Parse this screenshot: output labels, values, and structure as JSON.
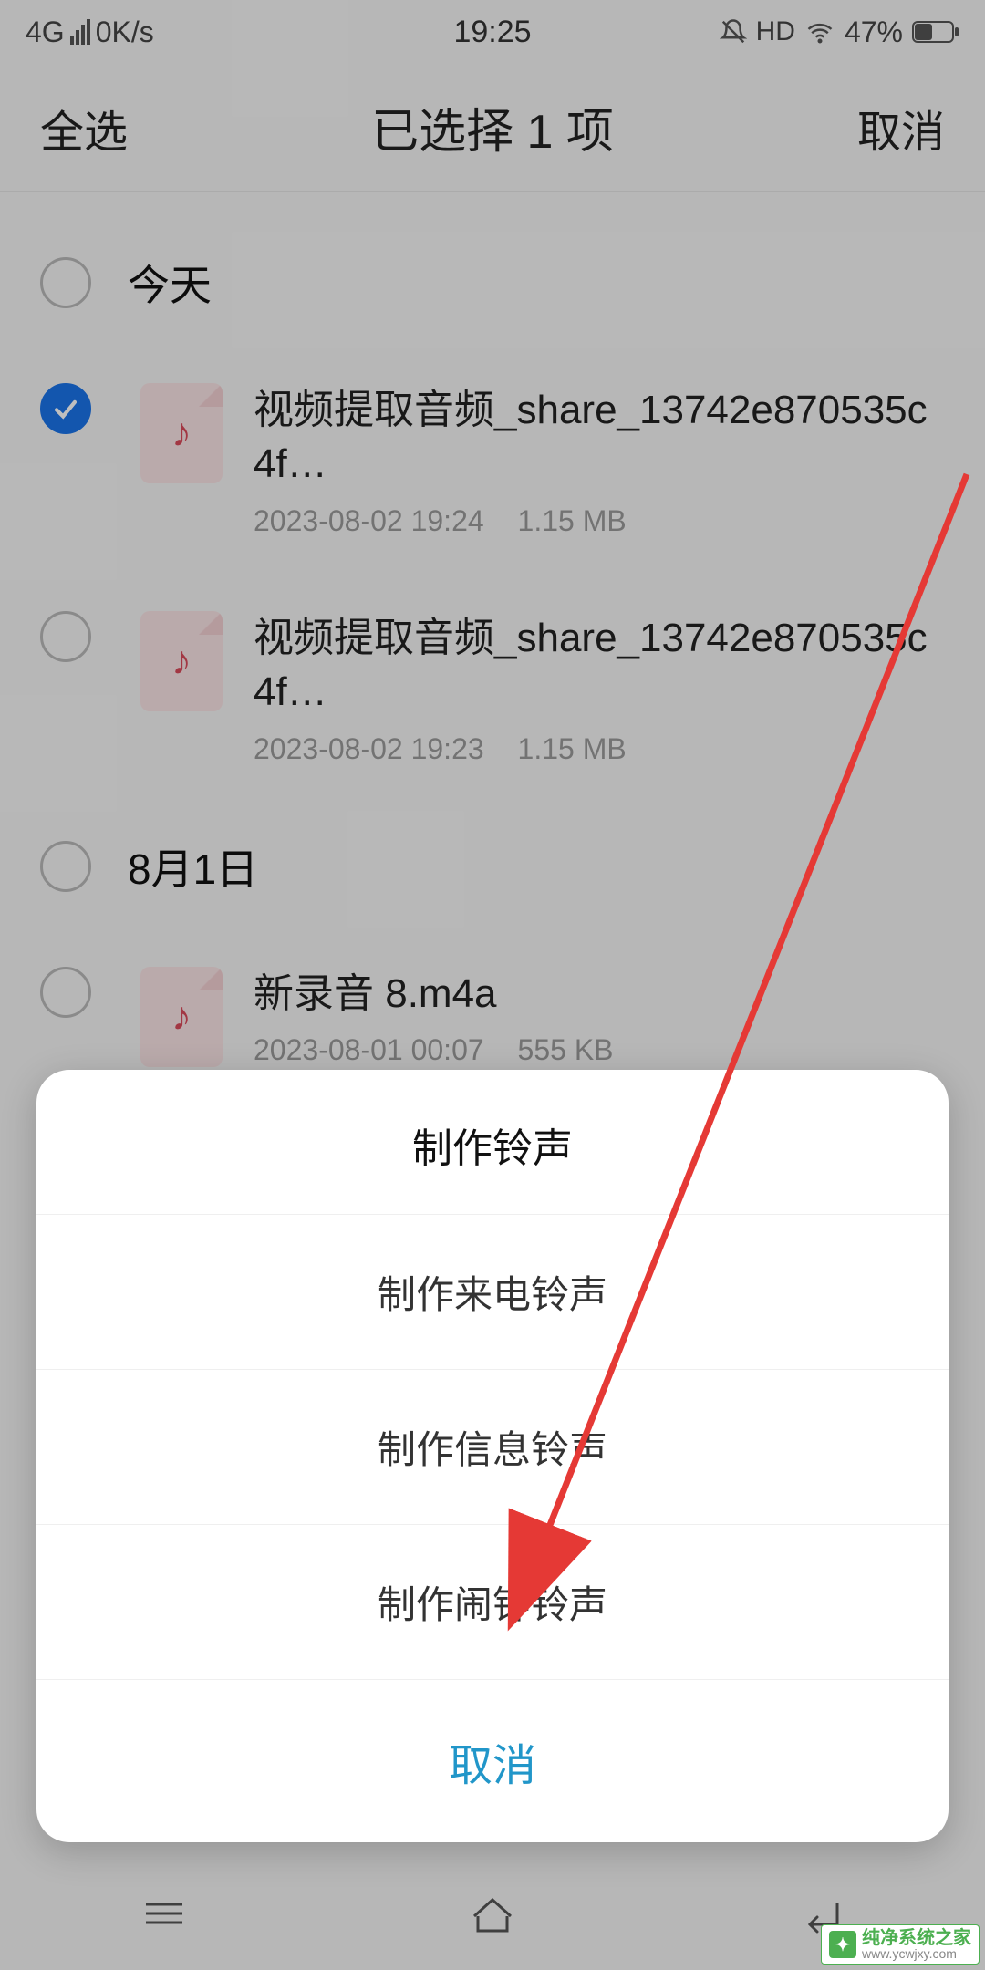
{
  "status": {
    "network": "4G",
    "speed": "0K/s",
    "time": "19:25",
    "hd": "HD",
    "battery_pct": "47%"
  },
  "header": {
    "select_all": "全选",
    "title": "已选择 1 项",
    "cancel": "取消"
  },
  "sections": [
    {
      "label": "今天",
      "checked": false
    },
    {
      "label": "8月1日",
      "checked": false
    }
  ],
  "files": [
    {
      "checked": true,
      "name": "视频提取音频_share_13742e870535c4f…",
      "date": "2023-08-02 19:24",
      "size": "1.15 MB"
    },
    {
      "checked": false,
      "name": "视频提取音频_share_13742e870535c4f…",
      "date": "2023-08-02 19:23",
      "size": "1.15 MB"
    },
    {
      "checked": false,
      "name": "新录音 8.m4a",
      "date": "2023-08-01 00:07",
      "size": "555 KB"
    }
  ],
  "sheet": {
    "title": "制作铃声",
    "items": [
      "制作来电铃声",
      "制作信息铃声",
      "制作闹钟铃声"
    ],
    "cancel": "取消"
  },
  "watermark": {
    "main": "纯净系统之家",
    "sub": "www.ycwjxy.com"
  }
}
